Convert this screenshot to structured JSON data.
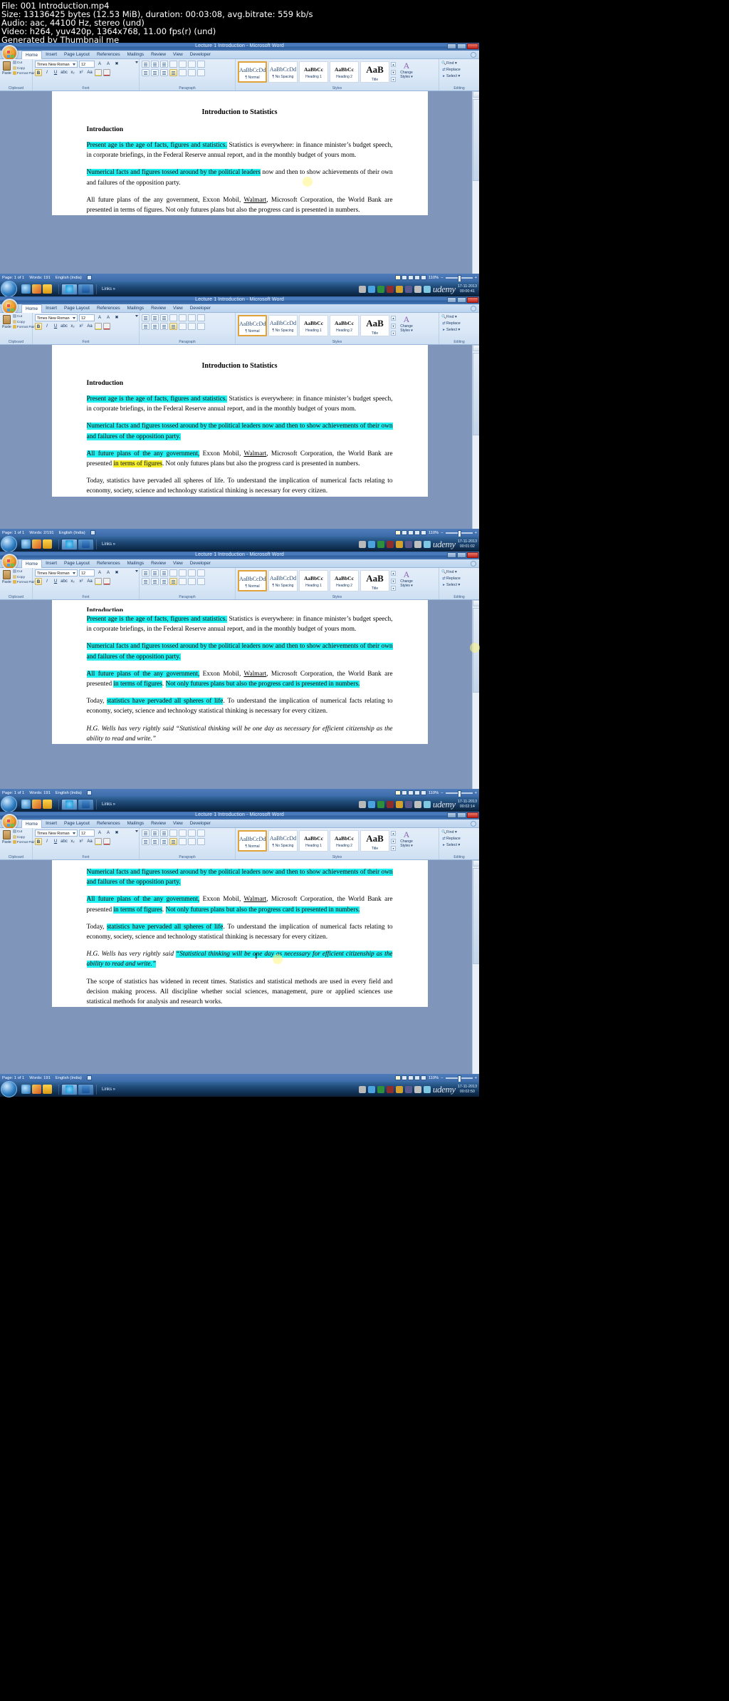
{
  "video_info": {
    "line1": "File: 001 Introduction.mp4",
    "line2": "Size: 13136425 bytes (12.53 MiB), duration: 00:03:08, avg.bitrate: 559 kb/s",
    "line3": "Audio: aac, 44100 Hz, stereo (und)",
    "line4": "Video: h264, yuv420p, 1364x768, 11.00 fps(r) (und)",
    "line5": "Generated by Thumbnail me"
  },
  "window": {
    "title": "Lecture 1 Introduction - Microsoft Word",
    "minimize": "—",
    "maximize": "❑",
    "close": "✕"
  },
  "ribbon": {
    "tabs": [
      "Home",
      "Insert",
      "Page Layout",
      "References",
      "Mailings",
      "Review",
      "View",
      "Developer"
    ],
    "active_tab": "Home",
    "groups": {
      "clipboard": {
        "label": "Clipboard",
        "paste": "Paste",
        "cut": "Cut",
        "copy": "Copy",
        "format_painter": "Format Painter"
      },
      "font": {
        "label": "Font",
        "font_name": "Times New Roman",
        "font_size": "12",
        "bold": "B",
        "italic": "I",
        "underline": "U",
        "strikethrough": "abc",
        "subscript": "x₂",
        "superscript": "x²",
        "grow": "A",
        "shrink": "A",
        "clear": "⌫",
        "highlight": "ab",
        "color": "A"
      },
      "paragraph": {
        "label": "Paragraph"
      },
      "styles": {
        "label": "Styles",
        "tiles": [
          {
            "preview": "AaBbCcDd",
            "name": "¶ Normal",
            "selected": true
          },
          {
            "preview": "AaBbCcDd",
            "name": "¶ No Spacing",
            "selected": false
          },
          {
            "preview": "AaBbCc",
            "name": "Heading 1",
            "selected": false
          },
          {
            "preview": "AaBbCc",
            "name": "Heading 2",
            "selected": false
          },
          {
            "preview": "AaB",
            "name": "Title",
            "selected": false
          }
        ],
        "change_styles": "Change\nStyles"
      },
      "editing": {
        "label": "Editing",
        "find": "Find",
        "replace": "Replace",
        "select": "Select"
      }
    }
  },
  "document": {
    "title": "Introduction to Statistics",
    "heading": "Introduction",
    "p1_hl": "Present age is the age of facts, figures and statistics.",
    "p1_rest": "  Statistics is everywhere: in finance minister’s budget speech, in corporate briefings, in the Federal Reserve annual report, and in the monthly budget of yours mom.",
    "p2_a": "Numerical facts and figures tossed around by the political leaders",
    "p2_b": " now and then to show achievements of their own and failures of the opposition party.",
    "p3_a": "All future plans of the any government,",
    "p3_b": " Exxon Mobil, ",
    "p3_walmart": "Walmart",
    "p3_c": ", Microsoft Corporation, the World Bank are presented ",
    "p3_d": "in terms of figures",
    "p3_e": ". ",
    "p3_f": "Not only futures plans but also the progress card is presented in numbers.",
    "p4_a": "Today, ",
    "p4_b": "statistics have pervaded all spheres of life",
    "p4_c": ". To understand the implication of numerical facts relating to economy, society, science and technology statistical thinking is necessary for every citizen.",
    "p5_a": "H.G. Wells",
    "p5_b": " has very rightly said ",
    "p5_quote": "“Statistical thinking will be one day as necessary for efficient citizenship as the ability to read and write.”",
    "p6": "The scope of statistics has widened in recent times. Statistics and statistical methods are used in every field and decision making process. All discipline whether social sciences, management, pure or applied sciences use statistical methods for analysis and research works."
  },
  "statusbar": {
    "page": "Page: 1 of 1",
    "words_default": "Words: 191",
    "words_selection": "Words: 2/191",
    "language": "English (India)",
    "zoom": "110%"
  },
  "taskbar": {
    "links_label": "Links",
    "watermark": "udemy",
    "clocks": [
      {
        "time": "17-11-2013",
        "date": "00:00:41"
      },
      {
        "time": "17-11-2013",
        "date": "00:01:02"
      },
      {
        "time": "17-11-2013",
        "date": "00:02:14"
      },
      {
        "time": "17-11-2013",
        "date": "00:02:50"
      }
    ],
    "word_item": "Lecture 1 Introduction..."
  },
  "panels": [
    {
      "index": 1,
      "words": "Words: 191",
      "timestamp": "00:00:41"
    },
    {
      "index": 2,
      "words": "Words: 2/191",
      "timestamp": "00:01:02"
    },
    {
      "index": 3,
      "words": "Words: 191",
      "timestamp": "00:02:14"
    },
    {
      "index": 4,
      "words": "Words: 191",
      "timestamp": "00:02:50"
    }
  ],
  "colors": {
    "highlight_cyan": "#23f0f0",
    "highlight_yellow": "#f6f02a",
    "titlebar_blue": "#3e6eb0",
    "close_red": "#c0201a",
    "desktop": "#7f95ba"
  }
}
